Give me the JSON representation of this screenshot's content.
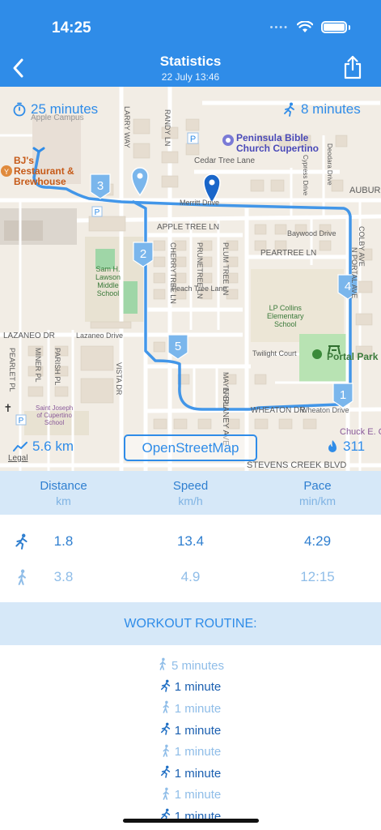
{
  "status_bar": {
    "time": "14:25"
  },
  "header": {
    "title": "Statistics",
    "subtitle": "22 July 13:46"
  },
  "map": {
    "overlay": {
      "duration": "25 minutes",
      "walk_time": "8 minutes",
      "distance": "5.6 km",
      "calories": "311",
      "attribution_button": "OpenStreetMap",
      "legal": "Legal"
    },
    "waypoints": [
      "1",
      "2",
      "3",
      "4",
      "5"
    ],
    "pois": {
      "church": "Peninsula Bible\nChurch Cupertino",
      "restaurant": "BJ's\nRestaurant &\nBrewhouse",
      "middle_school": "Sam H.\nLawson\nMiddle\nSchool",
      "elementary": "LP Collins\nElementary\nSchool",
      "portal_park": "Portal Park",
      "st_joseph": "Saint Joseph\nof Cupertino\nSchool",
      "apple_campus": "Apple Campus",
      "chuck": "Chuck E. Ch"
    },
    "streets": {
      "merritt": "Merritt Drive",
      "cedar": "Cedar Tree Lane",
      "appletree": "APPLE TREE LN",
      "peartree": "PEARTREE LN",
      "peach": "Peach Tree Lane",
      "lazaneo": "LAZANEO DR",
      "lazaneo2": "Lazaneo Drive",
      "wheaton": "WHEATON DR",
      "wheaton2": "Wheaton Drive",
      "stevens": "STEVENS CREEK BLVD",
      "blaney": "N BLANEY AVE",
      "larry": "LARRY WAY",
      "randy": "RANDY LN",
      "cherry": "CHERRYTREE LN",
      "prune": "PRUNETREE LN",
      "plum": "PLUM TREE LN",
      "baywood": "Baywood Drive",
      "twilight": "Twilight Court",
      "merriman": "MAYER PL",
      "parish": "PARISH PL",
      "miner": "MINER PL",
      "pearlet": "PEARLET PL",
      "vista": "VISTA DR",
      "cypress": "Cypress Drive",
      "devdara": "Deodara Drive",
      "colby": "COLBY AVE",
      "portal": "N PORTAL AVE",
      "sauburn": "AUBURN"
    }
  },
  "stats": {
    "headers": [
      {
        "label": "Distance",
        "unit": "km"
      },
      {
        "label": "Speed",
        "unit": "km/h"
      },
      {
        "label": "Pace",
        "unit": "min/km"
      }
    ],
    "rows": [
      {
        "mode": "run",
        "values": [
          "1.8",
          "13.4",
          "4:29"
        ]
      },
      {
        "mode": "walk",
        "values": [
          "3.8",
          "4.9",
          "12:15"
        ]
      }
    ]
  },
  "routine": {
    "title": "WORKOUT ROUTINE:",
    "items": [
      {
        "mode": "walk",
        "label": "5 minutes"
      },
      {
        "mode": "run",
        "label": "1 minute"
      },
      {
        "mode": "walk",
        "label": "1 minute"
      },
      {
        "mode": "run",
        "label": "1 minute"
      },
      {
        "mode": "walk",
        "label": "1 minute"
      },
      {
        "mode": "run",
        "label": "1 minute"
      },
      {
        "mode": "walk",
        "label": "1 minute"
      },
      {
        "mode": "run",
        "label": "1 minute"
      }
    ]
  },
  "colors": {
    "accent": "#2f8ce8",
    "header_bg": "#2f8ce8",
    "section_bg": "#d6e8f8",
    "strong_text": "#2f7fd0",
    "weak_text": "#8fbde8"
  }
}
